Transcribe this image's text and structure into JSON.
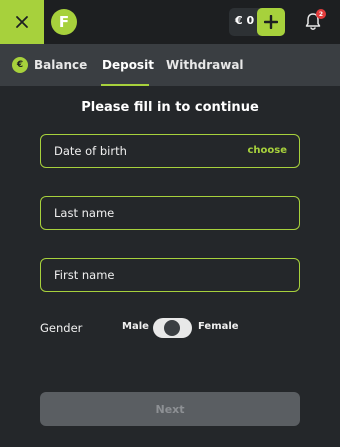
{
  "header": {
    "close_icon": "close-icon",
    "logo_letter": "F",
    "balance_amount": "€ 0",
    "add_icon": "plus-icon",
    "notification_icon": "bell-icon",
    "notification_count": "2"
  },
  "tabs": [
    {
      "label": "Balance",
      "icon_letter": "€",
      "active": false
    },
    {
      "label": "Deposit",
      "active": true
    },
    {
      "label": "Withdrawal",
      "active": false
    }
  ],
  "form": {
    "title": "Please fill in to continue",
    "dob_label": "Date of birth",
    "dob_action": "choose",
    "last_name_label": "Last name",
    "first_name_label": "First name",
    "gender_label": "Gender",
    "gender_male": "Male",
    "gender_female": "Female",
    "next_label": "Next"
  },
  "colors": {
    "accent": "#a7d13c",
    "background": "#24272a",
    "header_bg": "#1d1f21",
    "tabs_bg": "#3a3e42",
    "disabled_button": "#5a5e62",
    "badge": "#e23b3b"
  }
}
